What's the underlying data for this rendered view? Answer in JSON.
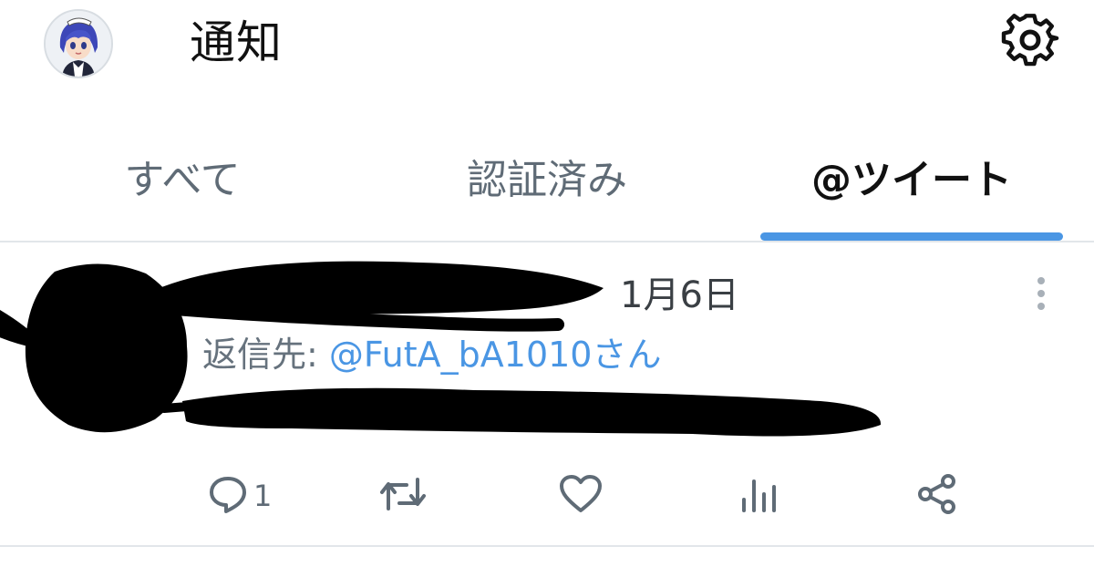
{
  "header": {
    "title": "通知",
    "avatar_icon": "avatar-icon",
    "settings_icon": "gear-icon"
  },
  "tabs": [
    {
      "label": "すべて",
      "active": false
    },
    {
      "label": "認証済み",
      "active": false
    },
    {
      "label": "@ツイート",
      "active": true
    }
  ],
  "tweet": {
    "date": "1月6日",
    "reply_prefix": "返信先: ",
    "reply_handle": "@FutA_bA1010さん",
    "more_icon": "more-vertical-icon",
    "actions": {
      "reply_count": "1",
      "icons": [
        "reply-icon",
        "retweet-icon",
        "like-icon",
        "analytics-icon",
        "share-icon"
      ]
    }
  },
  "colors": {
    "accent": "#4a96e4",
    "text": "#111111",
    "muted": "#5f6b76",
    "divider": "#e2e6ea",
    "redaction": "#000000"
  }
}
